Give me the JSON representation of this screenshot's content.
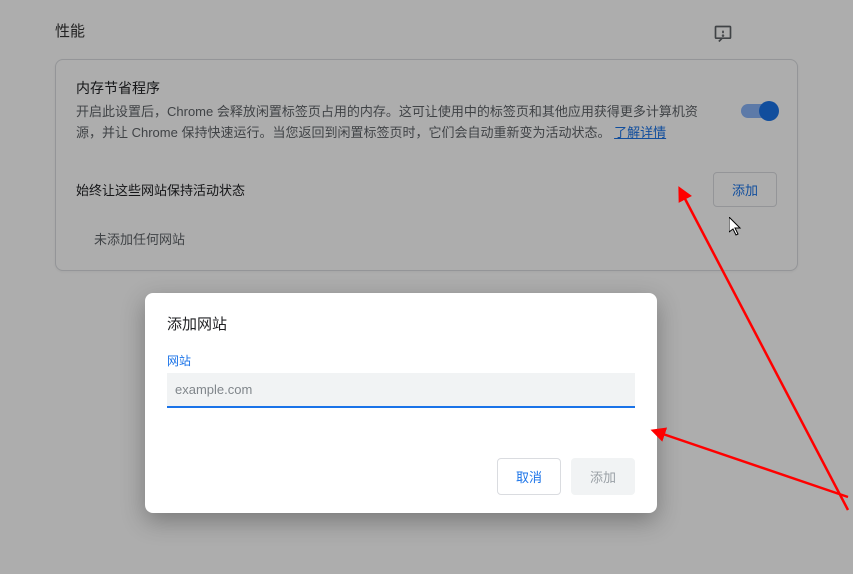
{
  "page": {
    "title": "性能"
  },
  "memory_saver": {
    "title": "内存节省程序",
    "description": "开启此设置后，Chrome 会释放闲置标签页占用的内存。这可让使用中的标签页和其他应用获得更多计算机资源，并让 Chrome 保持快速运行。当您返回到闲置标签页时，它们会自动重新变为活动状态。",
    "learn_more": "了解详情",
    "enabled": true
  },
  "always_active": {
    "label": "始终让这些网站保持活动状态",
    "add_button": "添加",
    "empty": "未添加任何网站"
  },
  "dialog": {
    "title": "添加网站",
    "field_label": "网站",
    "placeholder": "example.com",
    "value": "",
    "cancel": "取消",
    "confirm": "添加"
  }
}
